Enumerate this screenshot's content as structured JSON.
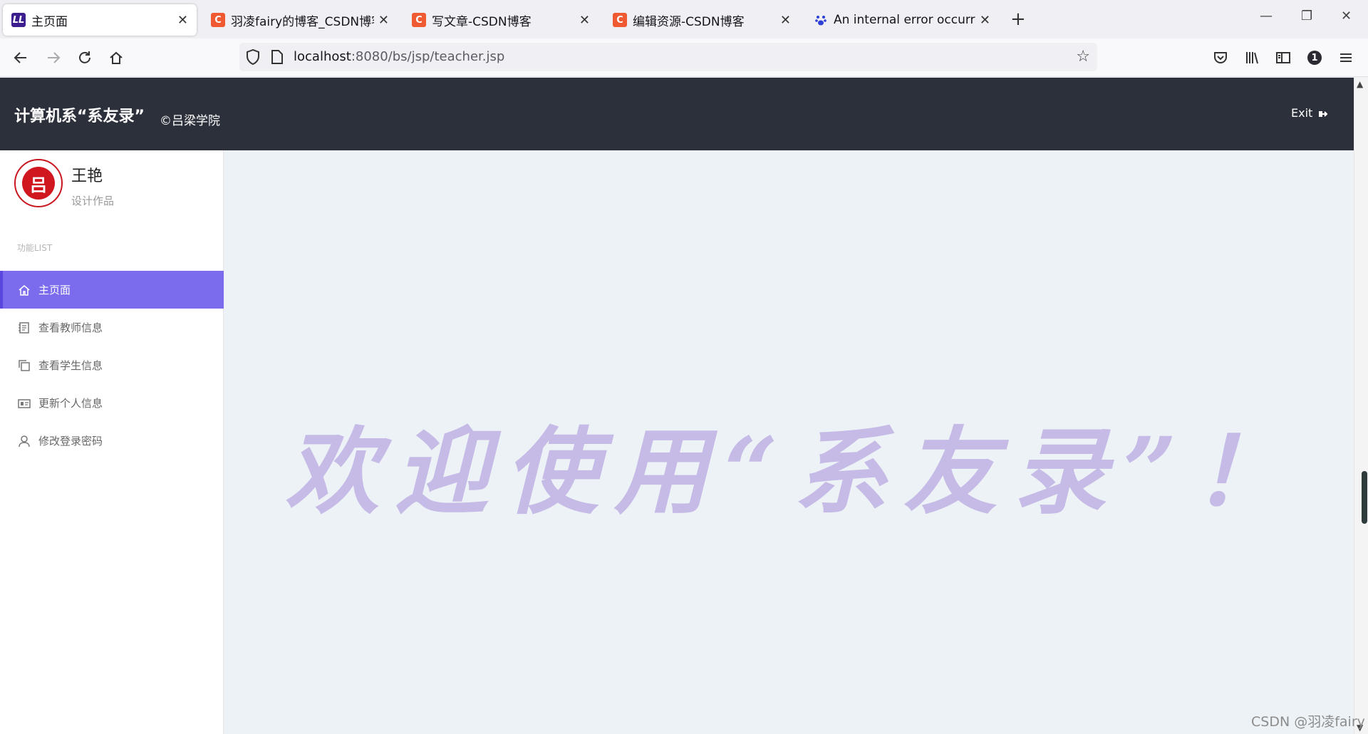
{
  "browser": {
    "tabs": [
      {
        "title": "主页面",
        "favicon": "ll-logo-icon",
        "favicon_color": "#3c1e8f",
        "active": true
      },
      {
        "title": "羽凌fairy的博客_CSDN博客-计",
        "favicon": "csdn-icon",
        "favicon_color": "#f05a32",
        "active": false
      },
      {
        "title": "写文章-CSDN博客",
        "favicon": "csdn-icon",
        "favicon_color": "#f05a32",
        "active": false
      },
      {
        "title": "编辑资源-CSDN博客",
        "favicon": "csdn-icon",
        "favicon_color": "#f05a32",
        "active": false
      },
      {
        "title": "An internal error occurred du",
        "favicon": "baidu-paw-icon",
        "favicon_color": "#2d3fd6",
        "active": false
      }
    ],
    "url_host": "localhost",
    "url_path": ":8080/bs/jsp/teacher.jsp",
    "account_badge": "1"
  },
  "header": {
    "title": "计算机系“系友录”",
    "subtitle": "©吕梁学院",
    "exit_label": "Exit",
    "background": "#2c303b"
  },
  "sidebar": {
    "user_name": "王艳",
    "user_role": "设计作品",
    "section_label": "功能LIST",
    "items": [
      {
        "label": "主页面",
        "icon": "home-icon",
        "active": true
      },
      {
        "label": "查看教师信息",
        "icon": "notebook-icon",
        "active": false
      },
      {
        "label": "查看学生信息",
        "icon": "copy-icon",
        "active": false
      },
      {
        "label": "更新个人信息",
        "icon": "id-card-icon",
        "active": false
      },
      {
        "label": "修改登录密码",
        "icon": "user-icon",
        "active": false
      }
    ],
    "accent": "#7b6ced"
  },
  "main": {
    "welcome_text": "欢迎使用“系友录”！",
    "background": "#edf2f6",
    "welcome_color": "#c5bbe6"
  },
  "watermark": "CSDN @羽凌fairy"
}
